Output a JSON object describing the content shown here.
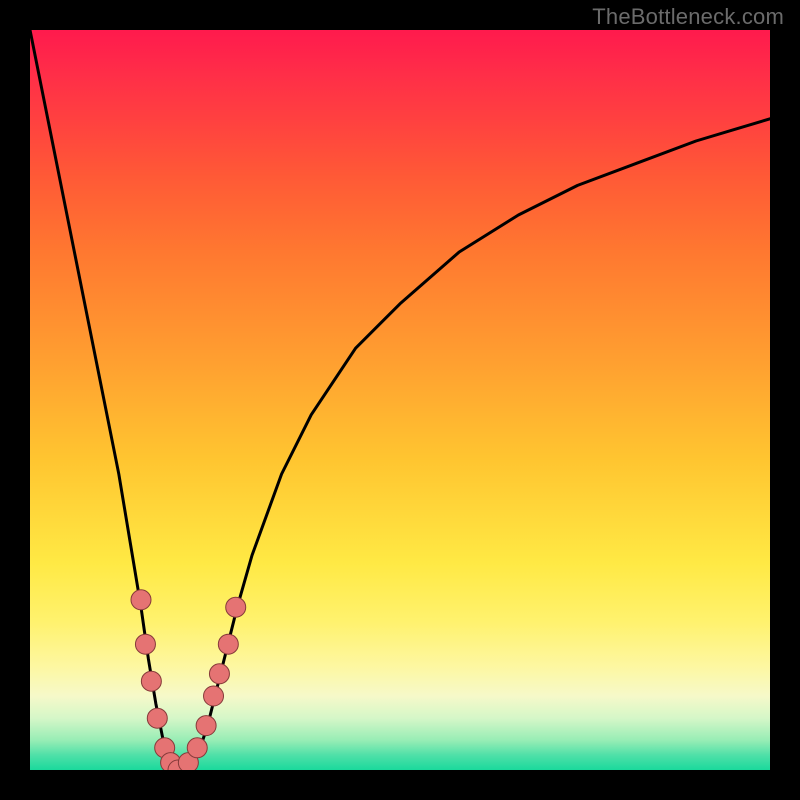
{
  "watermark": "TheBottleneck.com",
  "colors": {
    "frame": "#000000",
    "curve": "#000000",
    "dot_fill": "#e57373",
    "dot_stroke": "#863a3a",
    "gradient_top": "#ff1a4d",
    "gradient_bottom": "#1ad99c"
  },
  "chart_data": {
    "type": "line",
    "title": "",
    "xlabel": "",
    "ylabel": "",
    "xlim": [
      0,
      100
    ],
    "ylim": [
      0,
      100
    ],
    "note": "V-shaped bottleneck curve; y ≈ 100 at x=0, dips to ~0 near x≈20, rises toward ~88 at x=100. Left branch steeper than right.",
    "series": [
      {
        "name": "bottleneck-curve",
        "x": [
          0,
          2,
          4,
          6,
          8,
          10,
          12,
          14,
          15,
          16,
          17,
          18,
          19,
          20,
          21,
          22,
          23,
          24,
          25,
          26,
          28,
          30,
          34,
          38,
          44,
          50,
          58,
          66,
          74,
          82,
          90,
          100
        ],
        "y": [
          100,
          90,
          80,
          70,
          60,
          50,
          40,
          28,
          22,
          15,
          9,
          4,
          1,
          0,
          0,
          1,
          3,
          6,
          10,
          14,
          22,
          29,
          40,
          48,
          57,
          63,
          70,
          75,
          79,
          82,
          85,
          88
        ]
      }
    ],
    "dots": [
      {
        "x": 15.0,
        "y": 23
      },
      {
        "x": 15.6,
        "y": 17
      },
      {
        "x": 16.4,
        "y": 12
      },
      {
        "x": 17.2,
        "y": 7
      },
      {
        "x": 18.2,
        "y": 3
      },
      {
        "x": 19.0,
        "y": 1
      },
      {
        "x": 20.0,
        "y": 0
      },
      {
        "x": 21.4,
        "y": 1
      },
      {
        "x": 22.6,
        "y": 3
      },
      {
        "x": 23.8,
        "y": 6
      },
      {
        "x": 24.8,
        "y": 10
      },
      {
        "x": 25.6,
        "y": 13
      },
      {
        "x": 26.8,
        "y": 17
      },
      {
        "x": 27.8,
        "y": 22
      }
    ]
  }
}
